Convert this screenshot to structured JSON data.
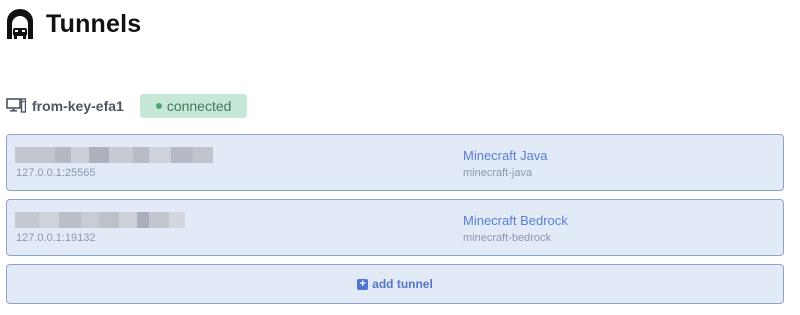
{
  "header": {
    "title": "Tunnels",
    "icon": "tunnel-icon"
  },
  "agent": {
    "icon": "computer-icon",
    "name": "from-key-efa1",
    "status": "connected",
    "status_color": "#4aa56c"
  },
  "tunnels": [
    {
      "local_address": "127.0.0.1:25565",
      "name": "Minecraft Java",
      "slug": "minecraft-java"
    },
    {
      "local_address": "127.0.0.1:19132",
      "name": "Minecraft Bedrock",
      "slug": "minecraft-bedrock"
    }
  ],
  "add_tunnel": {
    "label": "add tunnel",
    "icon": "plus-icon"
  },
  "colors": {
    "card_bg": "#e2eaf8",
    "card_border": "#8fa3c6",
    "link_blue": "#5a7fd0"
  }
}
